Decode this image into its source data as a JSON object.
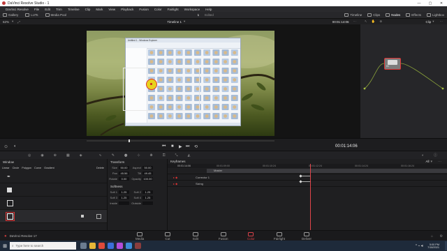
{
  "window": {
    "title": "DaVinci Resolve Studio - 1"
  },
  "menu": [
    "DaVinci Resolve",
    "File",
    "Edit",
    "Trim",
    "Timeline",
    "Clip",
    "Mark",
    "View",
    "Playback",
    "Fusion",
    "Color",
    "Fairlight",
    "Workspace",
    "Help"
  ],
  "toolbar": {
    "gallery": "Gallery",
    "luts": "LUTs",
    "media_pool": "Media Pool",
    "project_num": "1",
    "project_status": "Edited",
    "timeline": "Timeline",
    "clips": "Clips",
    "nodes": "Nodes",
    "effects": "Effects",
    "lightbox": "Lightbox"
  },
  "viewer": {
    "zoom": "62%",
    "timeline_name": "Timeline 1",
    "timecode": "00:01:14:06",
    "playhead_timecode": "00:01:14:06"
  },
  "node_panel": {
    "mode": "Clip",
    "node_label": "01"
  },
  "embedded_window": {
    "title": "Untitled 1 - Windows Explorer"
  },
  "window_panel": {
    "title": "Window",
    "shapes": [
      "Linear",
      "Circle",
      "Polygon",
      "Curve",
      "Gradient"
    ],
    "delete": "Delete"
  },
  "transform": {
    "title": "Transform",
    "size_label": "Size",
    "size": "50.00",
    "aspect_label": "Aspect",
    "aspect": "50.00",
    "pan_label": "Pan",
    "pan": "45.56",
    "tilt_label": "Tilt",
    "tilt": "49.45",
    "rotate_label": "Rotate",
    "rotate": "0.00",
    "opacity_label": "Opacity",
    "opacity": "100.00"
  },
  "softness": {
    "title": "Softness",
    "soft1_label": "Soft 1",
    "soft1": "1.25",
    "soft2_label": "Soft 2",
    "soft2": "1.25",
    "soft3_label": "Soft 3",
    "soft3": "1.25",
    "soft4_label": "Soft 4",
    "soft4": "1.25",
    "inside_label": "Inside",
    "inside": "",
    "outside_label": "Outside",
    "outside": ""
  },
  "keyframes": {
    "title": "Keyframes",
    "filter": "All",
    "current_tc": "00:01:14:06",
    "ruler": [
      "00:01:09:00",
      "00:01:10:24",
      "00:01:12:24",
      "00:01:14:24",
      "00:01:16:24"
    ],
    "rows": [
      "Master",
      "Corrector 1",
      "Sizing"
    ]
  },
  "pages": [
    "Media",
    "Cut",
    "Edit",
    "Fusion",
    "Color",
    "Fairlight",
    "Deliver"
  ],
  "active_page": "Color",
  "app_label": "DaVinci Resolve 17",
  "taskbar": {
    "search_placeholder": "Type here to search",
    "time": "5:00 PM",
    "date": "7/18/2021"
  },
  "colors": {
    "accent": "#e0444a",
    "active_page": "#d94149",
    "node": "#7d7d7d",
    "taskbar": "#1e2a3a"
  }
}
